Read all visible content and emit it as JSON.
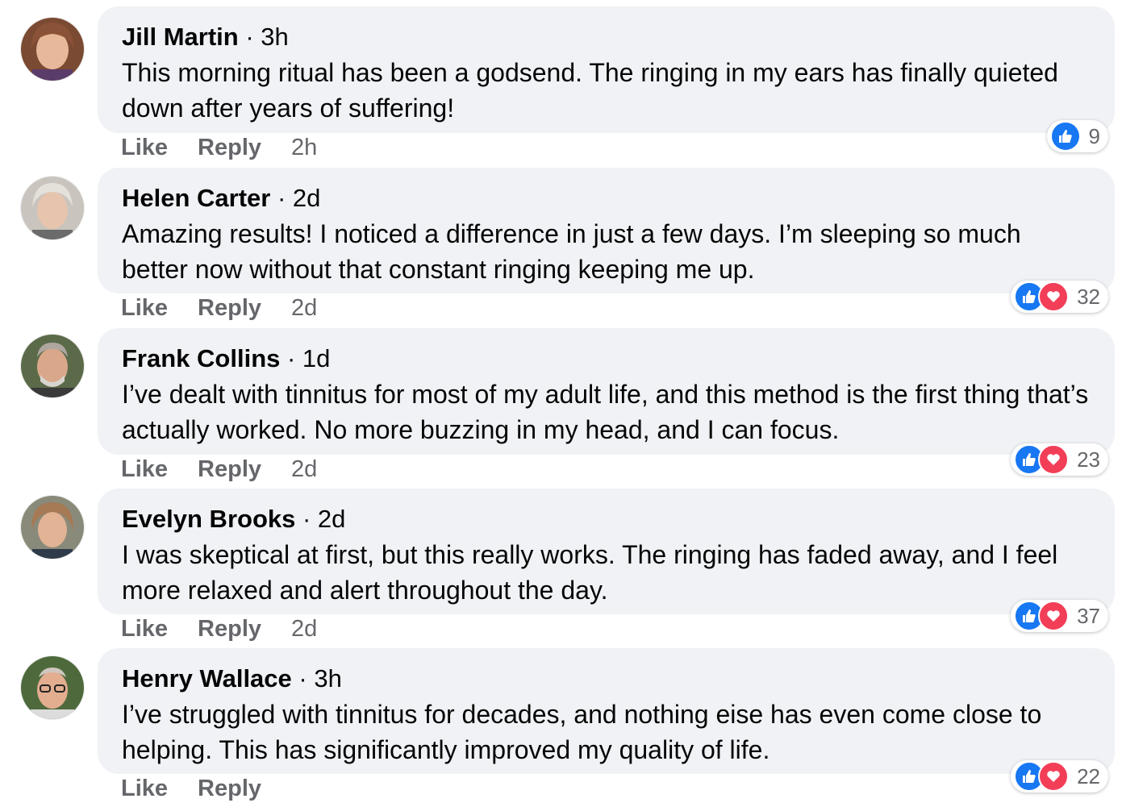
{
  "comments": [
    {
      "author": "Jill Martin",
      "posted": " · 3h",
      "text": "This morning ritual has been a godsend. The ringing in my ears has finally quieted down after years of suffering!",
      "like_label": "Like",
      "reply_label": "Reply",
      "time": "2h",
      "reaction_count": "9",
      "reactions": [
        "like-icon"
      ]
    },
    {
      "author": "Helen Carter",
      "posted": " · 2d",
      "text": "Amazing results! I noticed a difference in just a few days. I’m sleeping so much better now without that constant ringing keeping me up.",
      "like_label": "Like",
      "reply_label": "Reply",
      "time": "2d",
      "reaction_count": "32",
      "reactions": [
        "like-icon",
        "love-icon"
      ]
    },
    {
      "author": "Frank Collins",
      "posted": " · 1d",
      "text": "I’ve dealt with tinnitus for most of my adult life, and this method is the first thing that’s actually worked. No more buzzing in my head, and I can focus.",
      "like_label": "Like",
      "reply_label": "Reply",
      "time": "2d",
      "reaction_count": "23",
      "reactions": [
        "like-icon",
        "love-icon"
      ]
    },
    {
      "author": "Evelyn Brooks",
      "posted": " · 2d",
      "text": "I was skeptical at first, but this really works. The ringing has faded away, and I feel more relaxed and alert throughout the day.",
      "like_label": "Like",
      "reply_label": "Reply",
      "time": "2d",
      "reaction_count": "37",
      "reactions": [
        "like-icon",
        "love-icon"
      ]
    },
    {
      "author": "Henry Wallace",
      "posted": " · 3h",
      "text": "I’ve struggled with tinnitus for decades, and nothing eise has even come close to helping. This has significantly improved my quality of life.",
      "like_label": "Like",
      "reply_label": "Reply",
      "time": "",
      "reaction_count": "22",
      "reactions": [
        "like-icon",
        "love-icon"
      ]
    }
  ],
  "colors": {
    "bubble": "#f0f2f5",
    "secondary_text": "#65676b",
    "like_blue": "#1877f2",
    "love_red": "#f33e58"
  }
}
